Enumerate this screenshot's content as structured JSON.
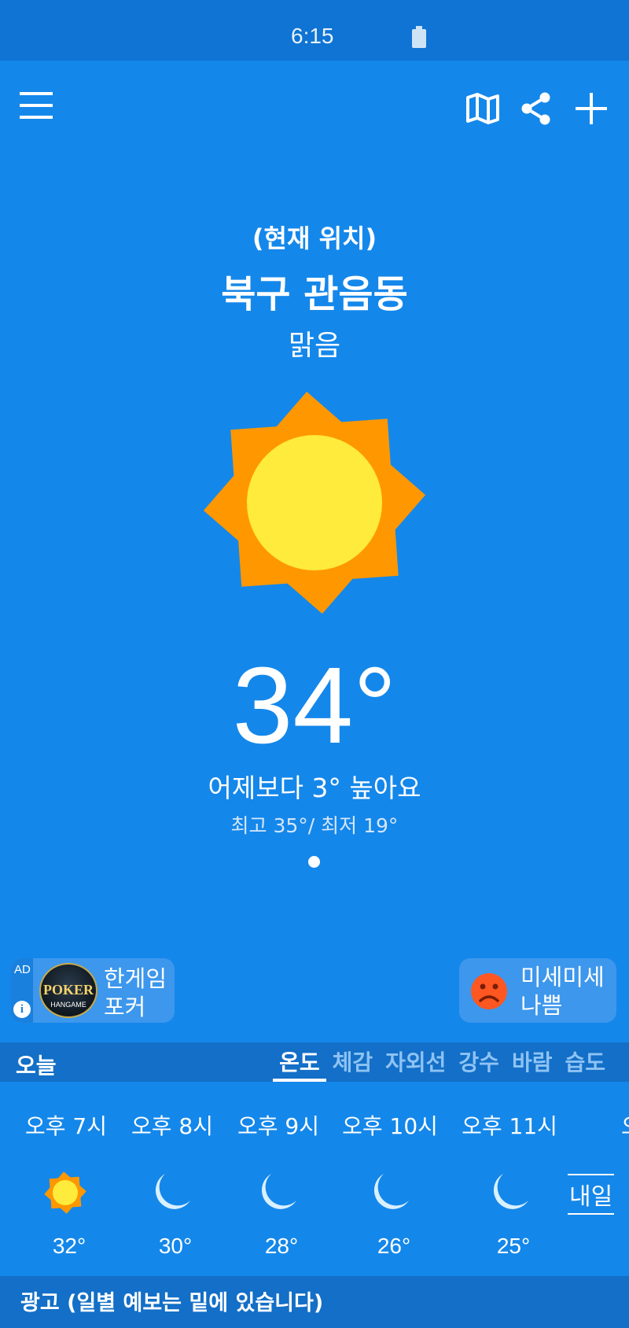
{
  "status": {
    "time": "6:15"
  },
  "toolbar": {
    "menu_icon": "menu-icon",
    "map_icon": "map-icon",
    "share_icon": "share-icon",
    "add_icon": "plus-icon"
  },
  "location": {
    "current_label": "(현재 위치)",
    "name": "북구 관음동",
    "condition": "맑음"
  },
  "current": {
    "temp": "34°",
    "compare": "어제보다 3° 높아요",
    "hilo": "최고 35°/ 최저 19°",
    "icon": "sun-icon"
  },
  "ad": {
    "tag": "AD",
    "info": "i",
    "logo_text": "POKER",
    "logo_sub": "HANGAME",
    "title_line1": "한게임",
    "title_line2": "포커"
  },
  "dust": {
    "line1": "미세미세",
    "line2": "나쁨",
    "icon": "sad-face-icon"
  },
  "tabs": {
    "today": "오늘",
    "items": [
      "온도",
      "체감",
      "자외선",
      "강수",
      "바람",
      "습도"
    ],
    "active": 0
  },
  "hourly": [
    {
      "time": "오후 7시",
      "icon": "sun-icon",
      "temp": "32°"
    },
    {
      "time": "오후 8시",
      "icon": "moon-icon",
      "temp": "30°"
    },
    {
      "time": "오후 9시",
      "icon": "moon-icon",
      "temp": "28°"
    },
    {
      "time": "오후 10시",
      "icon": "moon-icon",
      "temp": "26°"
    },
    {
      "time": "오후 11시",
      "icon": "moon-icon",
      "temp": "25°"
    }
  ],
  "tomorrow_label": "내일",
  "hour_cut": "오",
  "bottom": {
    "text": "광고 (일별 예보는 밑에 있습니다)"
  },
  "colors": {
    "background": "#1487ea",
    "sun_outer": "#ff9800",
    "sun_inner": "#ffeb3b"
  }
}
